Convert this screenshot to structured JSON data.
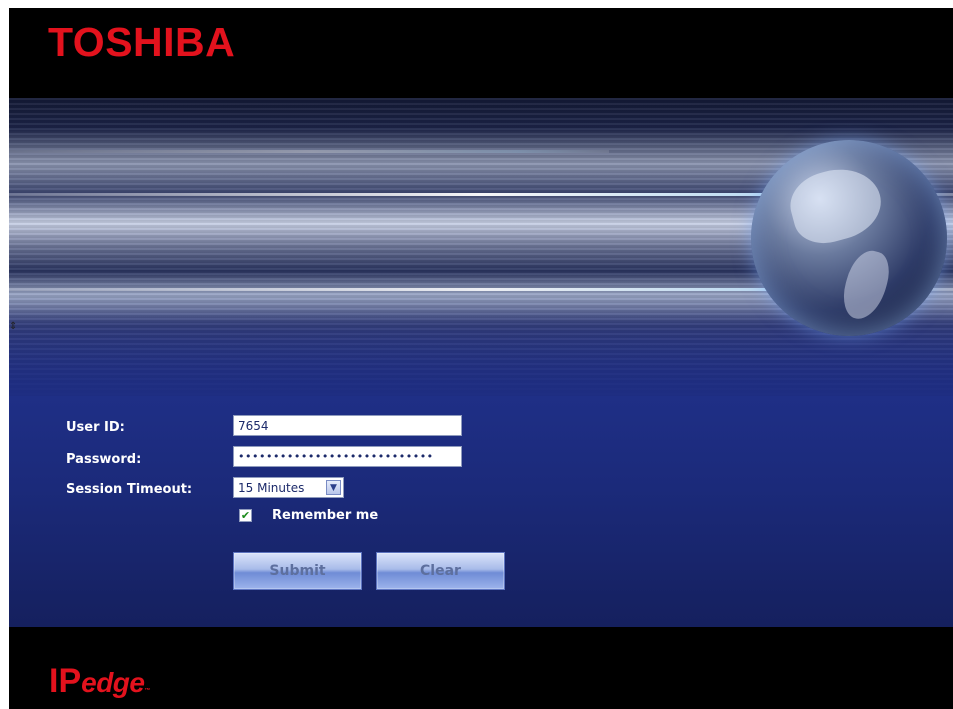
{
  "header": {
    "brand": "TOSHIBA"
  },
  "banner": {
    "scroll_glyph": "⇕"
  },
  "login": {
    "userid_label": "User ID:",
    "userid_value": "7654",
    "password_label": "Password:",
    "password_mask": "••••••••••••••••••••••••••••",
    "timeout_label": "Session Timeout:",
    "timeout_value": "15 Minutes",
    "remember_label": "Remember me",
    "remember_checked": true,
    "submit_label": "Submit",
    "clear_label": "Clear"
  },
  "footer": {
    "product_ip": "IP",
    "product_edge": "edge",
    "product_tm": "™"
  },
  "colors": {
    "brand_red": "#e3121d",
    "panel_blue": "#1f2f86"
  }
}
